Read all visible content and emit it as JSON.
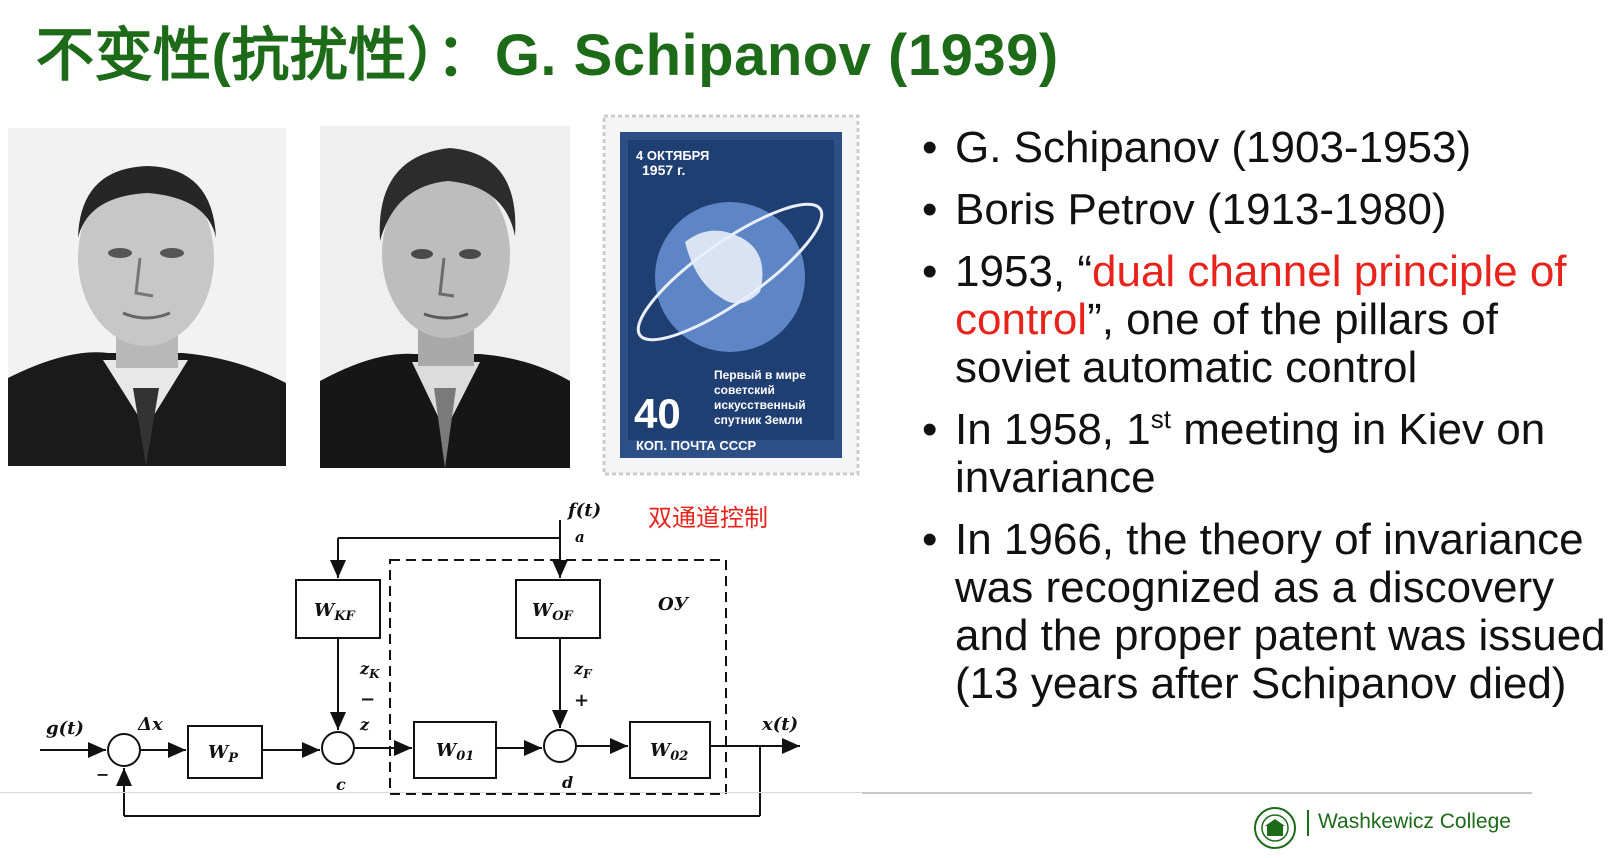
{
  "slide": {
    "title": "不变性(抗扰性）：G. Schipanov (1939)"
  },
  "bullets": [
    {
      "parts": [
        {
          "text": "G. Schipanov (1903-1953)",
          "red": false
        }
      ]
    },
    {
      "parts": [
        {
          "text": "Boris Petrov (1913-1980)",
          "red": false
        }
      ]
    },
    {
      "parts": [
        {
          "text": "1953, “",
          "red": false
        },
        {
          "text": "dual channel principle of control",
          "red": true
        },
        {
          "text": "”, one of the pillars of soviet automatic control",
          "red": false
        }
      ]
    },
    {
      "parts": [
        {
          "text": "In 1958, 1",
          "red": false
        },
        {
          "text": "st",
          "sup": true
        },
        {
          "text": " meeting in Kiev on invariance",
          "red": false
        }
      ]
    },
    {
      "parts": [
        {
          "text": "In 1966, the theory of invariance was recognized as a discovery and the proper patent was issued (13 years after Schipanov died)",
          "red": false
        }
      ]
    }
  ],
  "stamp": {
    "date_line1": "4 ОКТЯБРЯ",
    "date_line2": "1957 г.",
    "text": [
      "Первый в мире",
      "советский",
      "искусственный",
      "спутник Земли"
    ],
    "value": "40",
    "bottom": "КОП. ПОЧТА СССР"
  },
  "diagram": {
    "label": "双通道控制",
    "f": "f(t)",
    "a": "a",
    "g": "g(t)",
    "dx": "Δx",
    "x": "x(t)",
    "wkf": "W",
    "wkf_sub": "KF",
    "wof": "W",
    "wof_sub": "OF",
    "oy": "ОУ",
    "wp": "W",
    "wp_sub": "P",
    "w01": "W",
    "w01_sub": "01",
    "w02": "W",
    "w02_sub": "02",
    "zk": "z",
    "zk_sub": "K",
    "zf": "z",
    "zf_sub": "F",
    "z": "z",
    "c": "c",
    "d": "d",
    "minus1": "−",
    "minus2": "−",
    "plus": "+"
  },
  "footer": {
    "college": "Washkewicz College"
  }
}
